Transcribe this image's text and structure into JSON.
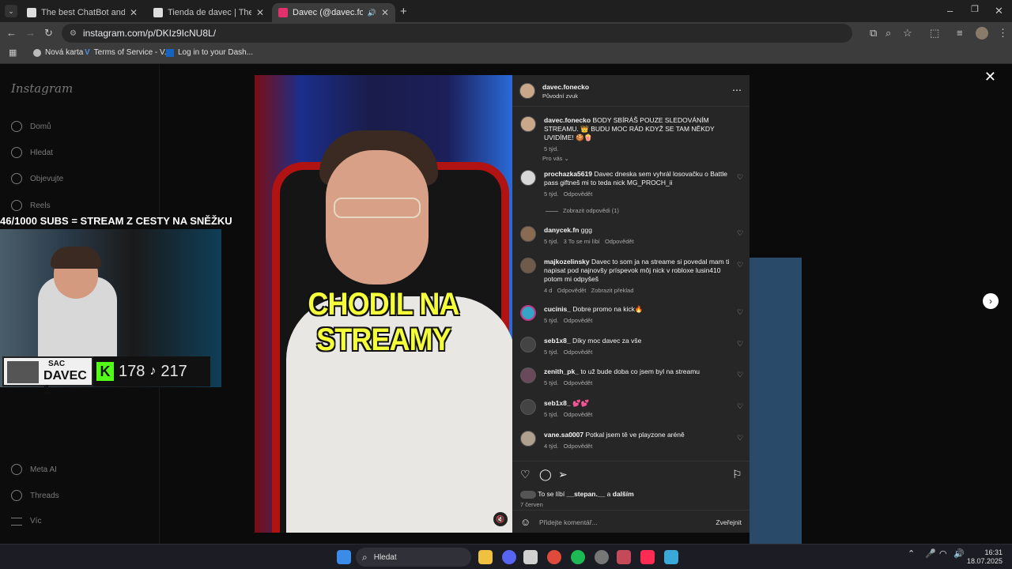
{
  "browser": {
    "tabs": [
      {
        "title": "The best ChatBot and Widgets",
        "favicon_color": "#cccccc"
      },
      {
        "title": "Tienda de davec | The best Cha",
        "favicon_color": "#cccccc"
      },
      {
        "title": "Davec (@davec.fonecko) •",
        "favicon_color": "#e1306c"
      }
    ],
    "url": "instagram.com/p/DKIz9IcNU8L/",
    "bookmarks": [
      "Nová karta",
      "Terms of Service - V...",
      "Log in to your Dash..."
    ]
  },
  "instagram": {
    "logo": "Instagram",
    "nav": [
      "Domů",
      "Hledat",
      "Objevujte",
      "Reels",
      "Meta AI",
      "Threads",
      "Víc"
    ],
    "video": {
      "caption_overlay": "CHODIL NA STREAMY",
      "stream_title": "46/1000 SUBS = STREAM Z CESTY NA SNĚŽKU",
      "sac_line1": "SAC",
      "sac_line2": "DAVEC 1",
      "kick_logo": "K",
      "kick_count": "178",
      "tiktok_count": "217"
    },
    "post": {
      "author": "davec.fonecko",
      "audio": "Původní zvuk",
      "caption_user": "davec.fonecko",
      "caption": "BODY SBÍRÁŠ POUZE SLEDOVÁNÍM STREAMU. 👑 BUDU MOC RÁD KDYŽ SE TAM NĚKDY UVIDÍME! 🍪🍿",
      "caption_time": "5 týd.",
      "filter": "Pro vás ⌄",
      "comments": [
        {
          "user": "prochazka5619",
          "text": "Davec dneska sem vyhrál losovačku o Battle pass giftneš mi to teda nick MG_PROCH_ii",
          "meta": "5 týd.   Odpovědět",
          "avatar": "#d8d8d8"
        },
        {
          "user": "danycek.fn",
          "text": "ggg",
          "meta": "5 týd.   3 To se mi líbí   Odpovědět",
          "avatar": "#8a6a50"
        },
        {
          "user": "majkozelinsky",
          "text": "Davec to som ja na streame si povedal mam ti napisat pod najnovšy príspevok môj nick v robloxe lusin410 potom mi odpyšeš",
          "meta": "4 d   Odpovědět   Zobrazit překlad",
          "avatar": "#705a4a"
        },
        {
          "user": "cucinis_",
          "text": "Dobre promo na kick🔥",
          "meta": "5 týd.   Odpovědět",
          "avatar": "#36a4c4"
        },
        {
          "user": "seb1x8_",
          "text": "Díky moc davec za vše",
          "meta": "5 týd.   Odpovědět",
          "avatar": "#444444"
        },
        {
          "user": "zenith_pk_",
          "text": "to už bude doba co jsem byl na streamu",
          "meta": "5 týd.   Odpovědět",
          "avatar": "#6a4a5a"
        },
        {
          "user": "seb1x8_",
          "text": "💕💕",
          "meta": "5 týd.   Odpovědět",
          "avatar": "#444444"
        },
        {
          "user": "vane.sa0007",
          "text": "Potkal jsem tě ve playzone aréně",
          "meta": "4 týd.   Odpovědět",
          "avatar": "#b0a090"
        }
      ],
      "replies_toggle": "Zobrazit odpovědi (1)",
      "likes_prefix": "To se líbí",
      "likes_user": "__stepan.__",
      "likes_connector": "a",
      "likes_others": "dalším",
      "date": "7 červen",
      "add_comment_placeholder": "Přidejte komentář...",
      "publish": "Zveřejnit"
    }
  },
  "taskbar": {
    "search": "Hledat",
    "time": "16:31",
    "date": "18.07.2025"
  }
}
